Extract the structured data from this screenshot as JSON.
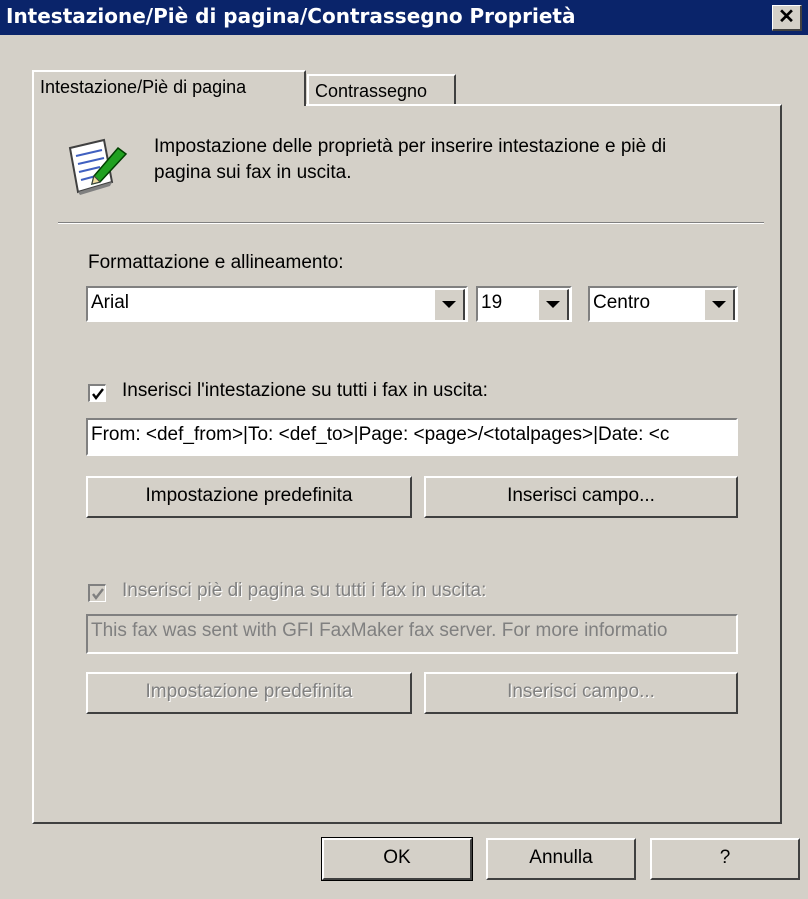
{
  "window": {
    "title": "Intestazione/Piè di pagina/Contrassegno Proprietà",
    "close_glyph": "✕"
  },
  "tabs": [
    {
      "label": "Intestazione/Piè di pagina",
      "selected": true
    },
    {
      "label": "Contrassegno",
      "selected": false
    }
  ],
  "description": {
    "icon": "document-pencil-icon",
    "line1": "Impostazione delle proprietà per inserire intestazione e piè di",
    "line2": "pagina sui fax in uscita."
  },
  "format": {
    "label": "Formattazione e allineamento:",
    "font": "Arial",
    "size": "19",
    "alignment": "Centro"
  },
  "header": {
    "checkbox_label": "Inserisci l'intestazione su tutti i fax in uscita:",
    "checked": true,
    "text": "From: <def_from>|To: <def_to>|Page: <page>/<totalpages>|Date: <c",
    "default_button": "Impostazione predefinita",
    "insert_button": "Inserisci campo..."
  },
  "footer": {
    "checkbox_label": "Inserisci piè di pagina su tutti i fax in uscita:",
    "checked": true,
    "disabled": true,
    "text": "This fax was sent with GFI FaxMaker fax server. For more informatio",
    "default_button": "Impostazione predefinita",
    "insert_button": "Inserisci campo..."
  },
  "buttons": {
    "ok": "OK",
    "cancel": "Annulla",
    "help": "?"
  }
}
